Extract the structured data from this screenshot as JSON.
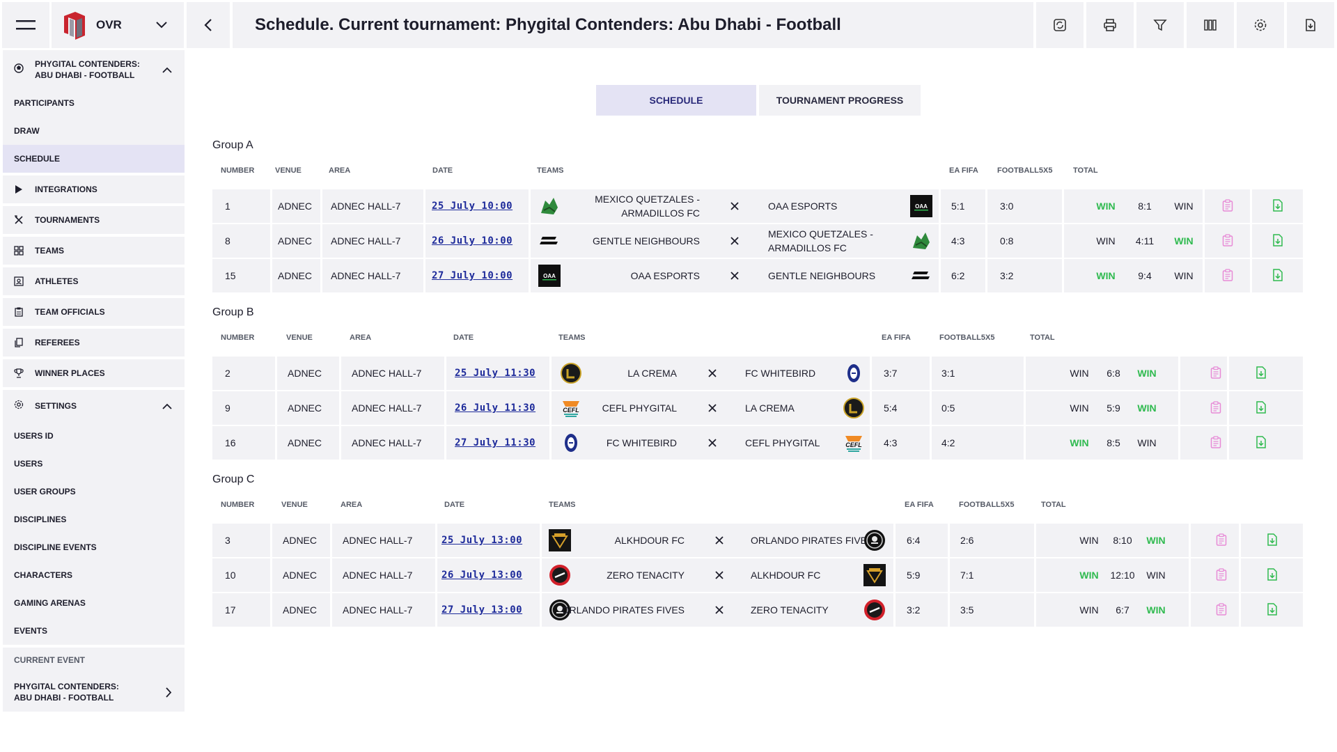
{
  "topbar": {
    "brand": "OVR",
    "title": "Schedule. Current tournament: Phygital Contenders: Abu Dhabi - Football",
    "tools": [
      "refresh-icon",
      "print-icon",
      "filter-icon",
      "columns-icon",
      "settings-icon",
      "export-icon"
    ]
  },
  "sidebar": {
    "tournament_header": "Phygital Contenders: Abu Dhabi - Football",
    "tournament_items": [
      "Participants",
      "Draw",
      "Schedule"
    ],
    "items": [
      {
        "label": "Integrations",
        "icon": "play-icon"
      },
      {
        "label": "Tournaments",
        "icon": "trophy-cross-icon"
      },
      {
        "label": "Teams",
        "icon": "grid-icon"
      },
      {
        "label": "Athletes",
        "icon": "athlete-icon"
      },
      {
        "label": "Team officials",
        "icon": "clipboard-icon"
      },
      {
        "label": "Referees",
        "icon": "copy-icon"
      },
      {
        "label": "Winner places",
        "icon": "cup-icon"
      }
    ],
    "settings_header": "Settings",
    "settings_items": [
      "Users ID",
      "Users",
      "User groups",
      "Disciplines",
      "Discipline events",
      "Characters",
      "Gaming arenas",
      "Events"
    ],
    "current_event_caption": "Current event",
    "current_event": "Phygital Contenders: Abu Dhabi - Football"
  },
  "tabs": [
    {
      "label": "Schedule",
      "active": true
    },
    {
      "label": "Tournament progress",
      "active": false
    }
  ],
  "columns": {
    "number": "Number",
    "venue": "Venue",
    "area": "Area",
    "date": "Date",
    "teams": "Teams",
    "ea_fifa": "EA FIFA",
    "football5x5": "Football5x5",
    "total": "Total"
  },
  "groups": [
    {
      "title": "Group A",
      "matches": [
        {
          "number": "1",
          "venue": "ADNEC",
          "area": "ADNEC HALL-7",
          "date": "25 July 10:00",
          "team1": "MEXICO QUETZALES - ARMADILLOS FC",
          "team2": "OAA ESPORTS",
          "ea_fifa": "5:1",
          "football5x5": "3:0",
          "left_result": "WIN",
          "total": "8:1",
          "right_result": "WIN",
          "left_win": true,
          "right_win": false
        },
        {
          "number": "8",
          "venue": "ADNEC",
          "area": "ADNEC HALL-7",
          "date": "26 July 10:00",
          "team1": "GENTLE NEIGHBOURS",
          "team2": "MEXICO QUETZALES - ARMADILLOS FC",
          "ea_fifa": "4:3",
          "football5x5": "0:8",
          "left_result": "WIN",
          "total": "4:11",
          "right_result": "WIN",
          "left_win": false,
          "right_win": true
        },
        {
          "number": "15",
          "venue": "ADNEC",
          "area": "ADNEC HALL-7",
          "date": "27 July 10:00",
          "team1": "OAA ESPORTS",
          "team2": "GENTLE NEIGHBOURS",
          "ea_fifa": "6:2",
          "football5x5": "3:2",
          "left_result": "WIN",
          "total": "9:4",
          "right_result": "WIN",
          "left_win": true,
          "right_win": false
        }
      ]
    },
    {
      "title": "Group B",
      "matches": [
        {
          "number": "2",
          "venue": "ADNEC",
          "area": "ADNEC HALL-7",
          "date": "25 July 11:30",
          "team1": "LA CREMA",
          "team2": "FC WHITEBIRD",
          "ea_fifa": "3:7",
          "football5x5": "3:1",
          "left_result": "WIN",
          "total": "6:8",
          "right_result": "WIN",
          "left_win": false,
          "right_win": true
        },
        {
          "number": "9",
          "venue": "ADNEC",
          "area": "ADNEC HALL-7",
          "date": "26 July 11:30",
          "team1": "CEFL PHYGITAL",
          "team2": "LA CREMA",
          "ea_fifa": "5:4",
          "football5x5": "0:5",
          "left_result": "WIN",
          "total": "5:9",
          "right_result": "WIN",
          "left_win": false,
          "right_win": true
        },
        {
          "number": "16",
          "venue": "ADNEC",
          "area": "ADNEC HALL-7",
          "date": "27 July 11:30",
          "team1": "FC WHITEBIRD",
          "team2": "CEFL PHYGITAL",
          "ea_fifa": "4:3",
          "football5x5": "4:2",
          "left_result": "WIN",
          "total": "8:5",
          "right_result": "WIN",
          "left_win": true,
          "right_win": false
        }
      ]
    },
    {
      "title": "Group C",
      "matches": [
        {
          "number": "3",
          "venue": "ADNEC",
          "area": "ADNEC HALL-7",
          "date": "25 July 13:00",
          "team1": "ALKHDOUR FC",
          "team2": "ORLANDO PIRATES FIVES",
          "ea_fifa": "6:4",
          "football5x5": "2:6",
          "left_result": "WIN",
          "total": "8:10",
          "right_result": "WIN",
          "left_win": false,
          "right_win": true
        },
        {
          "number": "10",
          "venue": "ADNEC",
          "area": "ADNEC HALL-7",
          "date": "26 July 13:00",
          "team1": "ZERO TENACITY",
          "team2": "ALKHDOUR FC",
          "ea_fifa": "5:9",
          "football5x5": "7:1",
          "left_result": "WIN",
          "total": "12:10",
          "right_result": "WIN",
          "left_win": true,
          "right_win": false
        },
        {
          "number": "17",
          "venue": "ADNEC",
          "area": "ADNEC HALL-7",
          "date": "27 July 13:00",
          "team1": "ORLANDO PIRATES FIVES",
          "team2": "ZERO TENACITY",
          "ea_fifa": "3:2",
          "football5x5": "3:5",
          "left_result": "WIN",
          "total": "6:7",
          "right_result": "WIN",
          "left_win": false,
          "right_win": true
        }
      ]
    }
  ],
  "colors": {
    "panel": "#f2f2f5",
    "active": "#e4e3f4",
    "date_link": "#1d2a9a",
    "win": "#2fba4f",
    "protocol_icon": "#e78ad6",
    "download_icon": "#2fba4f"
  }
}
